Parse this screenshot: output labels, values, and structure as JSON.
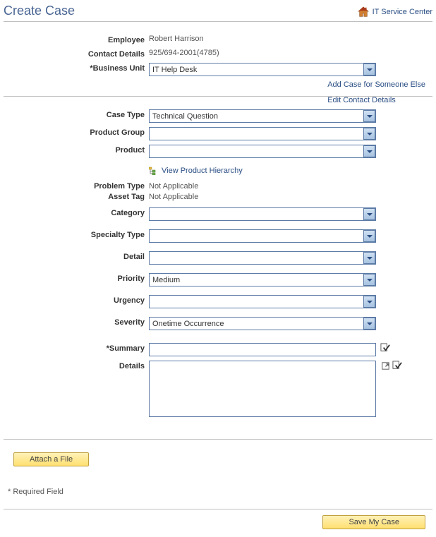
{
  "header": {
    "pageTitle": "Create Case",
    "serviceCenter": "IT Service Center"
  },
  "topLinks": {
    "addCase": "Add Case for Someone Else",
    "editContact": "Edit Contact Details"
  },
  "labels": {
    "employee": "Employee",
    "contactDetails": "Contact Details",
    "businessUnit": "*Business Unit",
    "caseType": "Case Type",
    "productGroup": "Product Group",
    "product": "Product",
    "viewHierarchy": "View Product Hierarchy",
    "problemType": "Problem Type",
    "assetTag": "Asset Tag",
    "category": "Category",
    "specialtyType": "Specialty Type",
    "detail": "Detail",
    "priority": "Priority",
    "urgency": "Urgency",
    "severity": "Severity",
    "summary": "*Summary",
    "details": "Details"
  },
  "values": {
    "employee": "Robert Harrison",
    "contactDetails": "925/694-2001(4785)",
    "businessUnit": "IT Help Desk",
    "caseType": "Technical Question",
    "productGroup": "",
    "product": "",
    "problemType": "Not Applicable",
    "assetTag": "Not Applicable",
    "category": "",
    "specialtyType": "",
    "detail": "",
    "priority": "Medium",
    "urgency": "",
    "severity": "Onetime Occurrence",
    "summary": "",
    "detailsText": ""
  },
  "buttons": {
    "attach": "Attach a File",
    "save": "Save My Case"
  },
  "footnote": "* Required Field"
}
